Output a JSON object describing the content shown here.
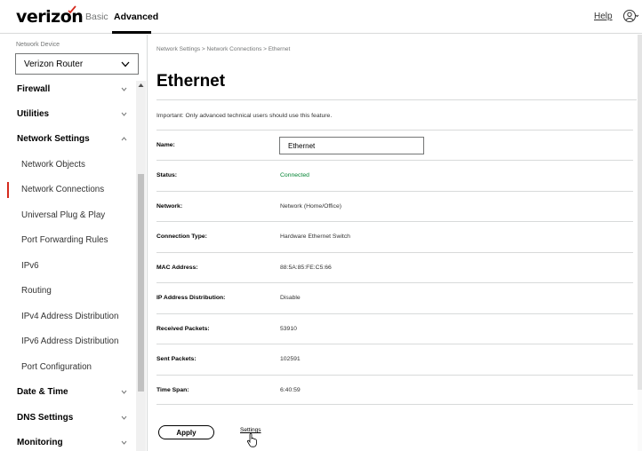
{
  "header": {
    "logo": "verizon",
    "nav": [
      {
        "label": "Basic"
      },
      {
        "label": "Advanced"
      }
    ],
    "help_label": "Help",
    "user_icon": "user-circle-icon",
    "brand_color": "#d52b1e"
  },
  "sidebar": {
    "device_label": "Network Device",
    "device_value": "Verizon Router",
    "items": [
      {
        "label": "Firewall",
        "type": "group"
      },
      {
        "label": "Utilities",
        "type": "group"
      },
      {
        "label": "Network Settings",
        "type": "group",
        "expanded": true
      },
      {
        "label": "Network Objects",
        "type": "sub"
      },
      {
        "label": "Network Connections",
        "type": "sub",
        "active": true
      },
      {
        "label": "Universal Plug & Play",
        "type": "sub"
      },
      {
        "label": "Port Forwarding Rules",
        "type": "sub"
      },
      {
        "label": "IPv6",
        "type": "sub"
      },
      {
        "label": "Routing",
        "type": "sub"
      },
      {
        "label": "IPv4 Address Distribution",
        "type": "sub"
      },
      {
        "label": "IPv6 Address Distribution",
        "type": "sub"
      },
      {
        "label": "Port Configuration",
        "type": "sub"
      },
      {
        "label": "Date & Time",
        "type": "group"
      },
      {
        "label": "DNS Settings",
        "type": "group"
      },
      {
        "label": "Monitoring",
        "type": "group"
      }
    ]
  },
  "main": {
    "breadcrumb": "Network Settings  >  Network Connections  >  Ethernet",
    "title": "Ethernet",
    "important": "Important: Only advanced technical users should use this feature.",
    "rows": [
      {
        "label": "Name:",
        "value": "Ethernet"
      },
      {
        "label": "Status:",
        "value": "Connected"
      },
      {
        "label": "Network:",
        "value": "Network (Home/Office)"
      },
      {
        "label": "Connection Type:",
        "value": "Hardware Ethernet Switch"
      },
      {
        "label": "MAC Address:",
        "value": "88:5A:85:FE:C5:66"
      },
      {
        "label": "IP Address Distribution:",
        "value": "Disable"
      },
      {
        "label": "Received Packets:",
        "value": "53910"
      },
      {
        "label": "Sent Packets:",
        "value": "102591"
      },
      {
        "label": "Time Span:",
        "value": "6:40:59"
      }
    ],
    "apply_label": "Apply",
    "settings_label": "Settings",
    "status_color": "#008331"
  }
}
